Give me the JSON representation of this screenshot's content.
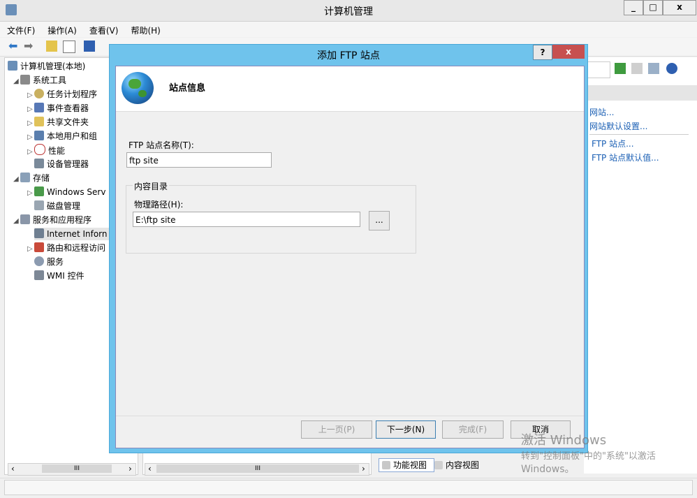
{
  "window": {
    "title": "计算机管理",
    "min_label": "_",
    "max_label": "□",
    "close_label": "x"
  },
  "menu": [
    "文件(F)",
    "操作(A)",
    "查看(V)",
    "帮助(H)"
  ],
  "tree": {
    "root": "计算机管理(本地)",
    "items": [
      {
        "label": "系统工具",
        "level": 1
      },
      {
        "label": "任务计划程序",
        "level": 2
      },
      {
        "label": "事件查看器",
        "level": 2
      },
      {
        "label": "共享文件夹",
        "level": 2
      },
      {
        "label": "本地用户和组",
        "level": 2
      },
      {
        "label": "性能",
        "level": 2
      },
      {
        "label": "设备管理器",
        "level": 2
      },
      {
        "label": "存储",
        "level": 1
      },
      {
        "label": "Windows Serv",
        "level": 2
      },
      {
        "label": "磁盘管理",
        "level": 2
      },
      {
        "label": "服务和应用程序",
        "level": 1
      },
      {
        "label": "Internet Inforn",
        "level": 2
      },
      {
        "label": "路由和远程访问",
        "level": 2
      },
      {
        "label": "服务",
        "level": 2
      },
      {
        "label": "WMI 控件",
        "level": 2
      }
    ]
  },
  "scroll_glyph": "III",
  "actions": {
    "links": [
      "网站...",
      "网站默认设置...",
      "FTP 站点...",
      "FTP 站点默认值..."
    ]
  },
  "bottom_tabs": {
    "feature": "功能视图",
    "content": "内容视图"
  },
  "dialog": {
    "title": "添加 FTP 站点",
    "help_label": "?",
    "close_label": "x",
    "header": "站点信息",
    "site_name_label": "FTP 站点名称(T):",
    "site_name_value": "ftp site",
    "group_label": "内容目录",
    "path_label": "物理路径(H):",
    "path_value": "E:\\ftp site",
    "browse_label": "...",
    "buttons": {
      "prev": "上一页(P)",
      "next": "下一步(N)",
      "finish": "完成(F)",
      "cancel": "取消"
    }
  },
  "watermark": {
    "line1": "激活 Windows",
    "line2": "转到\"控制面板\"中的\"系统\"以激活",
    "line3": "Windows。"
  },
  "colors": {
    "accent": "#6fc3ec",
    "link": "#1a5fb4"
  }
}
